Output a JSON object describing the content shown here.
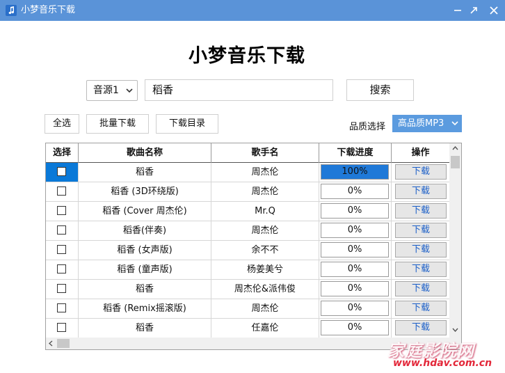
{
  "window": {
    "title": "小梦音乐下载"
  },
  "main": {
    "heading": "小梦音乐下载",
    "source_select": "音源1",
    "search_value": "稻香",
    "search_button": "搜索",
    "select_all": "全选",
    "batch_download": "批量下载",
    "download_dir": "下载目录",
    "quality_label": "品质选择",
    "quality_value": "高品质MP3"
  },
  "table": {
    "headers": [
      "选择",
      "歌曲名称",
      "歌手名",
      "下载进度",
      "操作"
    ],
    "rows": [
      {
        "selected": true,
        "song": "稻香",
        "artist": "周杰伦",
        "progress": "100%",
        "progress_value": 1.0,
        "action": "下载"
      },
      {
        "selected": false,
        "song": "稻香 (3D环绕版)",
        "artist": "周杰伦",
        "progress": "0%",
        "progress_value": 0,
        "action": "下载"
      },
      {
        "selected": false,
        "song": "稻香 (Cover 周杰伦)",
        "artist": "Mr.Q",
        "progress": "0%",
        "progress_value": 0,
        "action": "下载"
      },
      {
        "selected": false,
        "song": "稻香(伴奏)",
        "artist": "周杰伦",
        "progress": "0%",
        "progress_value": 0,
        "action": "下载"
      },
      {
        "selected": false,
        "song": "稻香 (女声版)",
        "artist": "余不不",
        "progress": "0%",
        "progress_value": 0,
        "action": "下载"
      },
      {
        "selected": false,
        "song": "稻香 (童声版)",
        "artist": "杨姜美兮",
        "progress": "0%",
        "progress_value": 0,
        "action": "下载"
      },
      {
        "selected": false,
        "song": "稻香",
        "artist": "周杰伦&派伟俊",
        "progress": "0%",
        "progress_value": 0,
        "action": "下载"
      },
      {
        "selected": false,
        "song": "稻香 (Remix摇滚版)",
        "artist": "周杰伦",
        "progress": "0%",
        "progress_value": 0,
        "action": "下载"
      },
      {
        "selected": false,
        "song": "稻香",
        "artist": "任嘉伦",
        "progress": "0%",
        "progress_value": 0,
        "action": "下载"
      }
    ]
  },
  "watermark": {
    "line1": "家庭影院网",
    "line2": "www.hdav.com.cn"
  },
  "icons": {
    "app": "music-note-icon",
    "minimize": "minimize-icon",
    "maximize": "maximize-icon",
    "close": "close-icon"
  },
  "colors": {
    "titlebar": "#5a93d8",
    "selected_cell": "#0a79d8",
    "progress_fill": "#1f79d8",
    "quality_select": "#5b9bdf",
    "download_text": "#1b5fc8"
  }
}
